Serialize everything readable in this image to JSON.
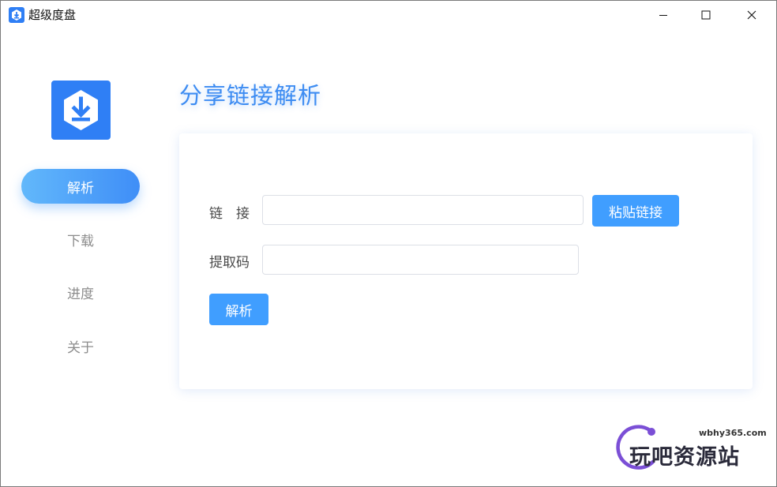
{
  "app": {
    "title": "超级度盘",
    "accent_color": "#409eff",
    "logo_icon": "download-icon"
  },
  "window_controls": [
    "minimize-icon",
    "maximize-icon",
    "close-icon"
  ],
  "sidebar": {
    "items": [
      {
        "label": "解析",
        "active": true
      },
      {
        "label": "下载",
        "active": false
      },
      {
        "label": "进度",
        "active": false
      },
      {
        "label": "关于",
        "active": false
      }
    ]
  },
  "main": {
    "title": "分享链接解析",
    "link_field": {
      "label": "链　接",
      "value": "",
      "placeholder": ""
    },
    "paste_button": "粘贴链接",
    "code_field": {
      "label": "提取码",
      "value": "",
      "placeholder": ""
    },
    "parse_button": "解析"
  },
  "watermark": {
    "url": "wbhy365.com",
    "text": "玩吧资源站"
  }
}
